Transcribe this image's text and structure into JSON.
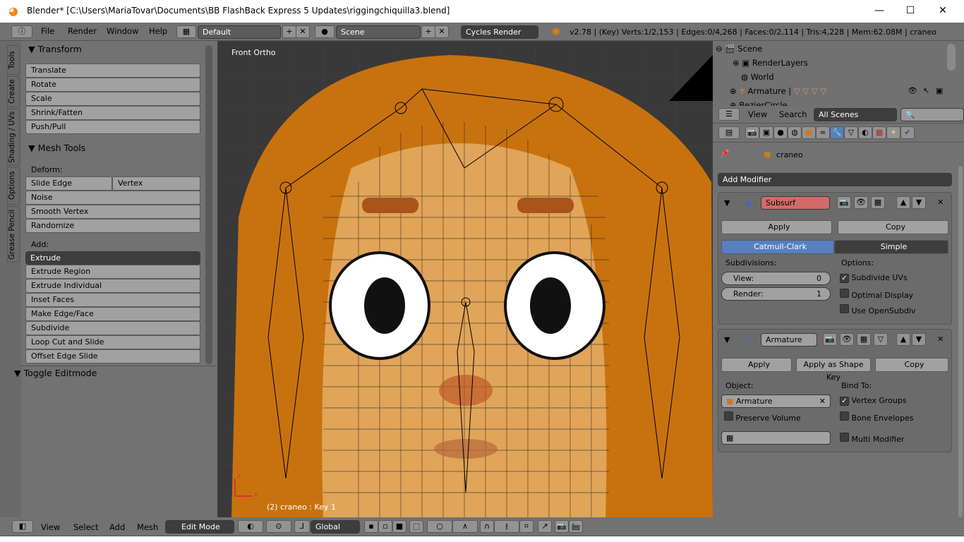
{
  "window": {
    "title": "Blender* [C:\\Users\\MariaTovar\\Documents\\BB FlashBack Express 5 Updates\\riggingchiquilla3.blend]",
    "minimize": "—",
    "maximize": "☐",
    "close": "✕"
  },
  "info_header": {
    "menus": [
      "File",
      "Render",
      "Window",
      "Help"
    ],
    "layout": "Default",
    "scene": "Scene",
    "engine": "Cycles Render",
    "stats": "v2.78 | (Key) Verts:1/2,153 | Edges:0/4,268 | Faces:0/2,114 | Tris:4,228 | Mem:62.08M | craneo"
  },
  "tool_tabs": [
    "Tools",
    "Create",
    "Shading / UVs",
    "Options",
    "Grease Pencil"
  ],
  "tools": {
    "transform_title": "Transform",
    "transform": [
      "Translate",
      "Rotate",
      "Scale",
      "Shrink/Fatten",
      "Push/Pull"
    ],
    "mesh_title": "Mesh Tools",
    "deform_label": "Deform:",
    "slide_edge": "Slide Edge",
    "vertex": "Vertex",
    "deform": [
      "Noise",
      "Smooth Vertex",
      "Randomize"
    ],
    "add_label": "Add:",
    "extrude": "Extrude",
    "add": [
      "Extrude Region",
      "Extrude Individual",
      "Inset Faces",
      "Make Edge/Face",
      "Subdivide",
      "Loop Cut and Slide",
      "Offset Edge Slide"
    ],
    "toggle_editmode": "Toggle Editmode"
  },
  "viewport": {
    "view_name": "Front Ortho",
    "object_info": "(2) craneo : Key 1",
    "axis_x": "x",
    "axis_z": "z",
    "colors": {
      "bg": "#393939",
      "hair": "#c8720f",
      "skin": "#e0a559"
    }
  },
  "outliner": {
    "items": [
      "Scene",
      "RenderLayers",
      "World",
      "Armature",
      "BezierCircle"
    ],
    "view": "View",
    "search": "Search",
    "filter": "All Scenes"
  },
  "properties": {
    "context": "craneo",
    "add_modifier": "Add Modifier",
    "subsurf": {
      "name": "Subsurf",
      "apply": "Apply",
      "copy": "Copy",
      "catmull": "Catmull-Clark",
      "simple": "Simple",
      "subdivisions": "Subdivisions:",
      "view_label": "View:",
      "view_value": "0",
      "render_label": "Render:",
      "render_value": "1",
      "options": "Options:",
      "opt": [
        {
          "label": "Subdivide UVs",
          "checked": true
        },
        {
          "label": "Optimal Display",
          "checked": false
        },
        {
          "label": "Use OpenSubdiv",
          "checked": false
        }
      ]
    },
    "armature": {
      "name": "Armature",
      "apply": "Apply",
      "apply_shape": "Apply as Shape Key",
      "copy": "Copy",
      "object_label": "Object:",
      "object": "Armature",
      "preserve_volume": "Preserve Volume",
      "bind_to": "Bind To:",
      "vertex_groups": "Vertex Groups",
      "bone_envelopes": "Bone Envelopes",
      "multi_modifier": "Multi Modifier"
    }
  },
  "view3d_header": {
    "menus": [
      "View",
      "Select",
      "Add",
      "Mesh"
    ],
    "mode": "Edit Mode",
    "orientation": "Global"
  }
}
